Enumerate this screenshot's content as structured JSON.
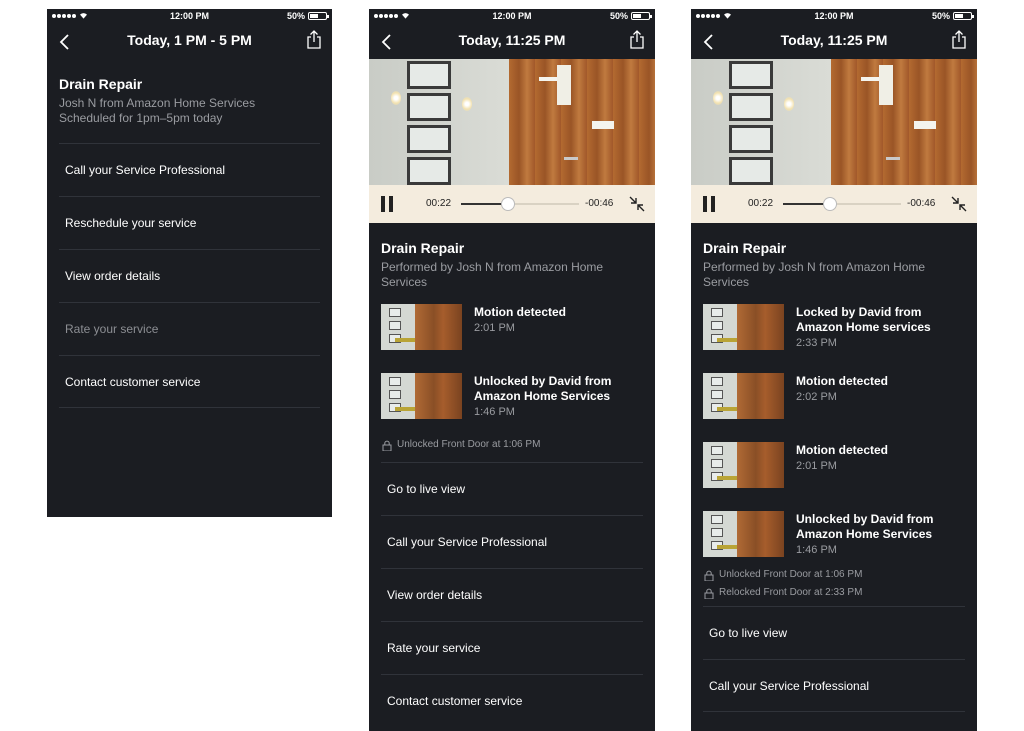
{
  "status_bar": {
    "time": "12:00 PM",
    "battery": "50%"
  },
  "phone1": {
    "nav_title": "Today, 1 PM - 5 PM",
    "service": {
      "title": "Drain Repair",
      "line1": "Josh N from Amazon Home Services",
      "line2": "Scheduled for 1pm–5pm today"
    },
    "menu": [
      {
        "label": "Call your Service Professional",
        "disabled": false
      },
      {
        "label": "Reschedule your service",
        "disabled": false
      },
      {
        "label": "View order details",
        "disabled": false
      },
      {
        "label": "Rate your service",
        "disabled": true
      },
      {
        "label": "Contact customer service",
        "disabled": false
      }
    ]
  },
  "phone2": {
    "nav_title": "Today, 11:25 PM",
    "video": {
      "elapsed": "00:22",
      "remaining": "-00:46",
      "progress": 0.4
    },
    "service": {
      "title": "Drain Repair",
      "subtitle": "Performed by Josh N from Amazon Home Services"
    },
    "events": [
      {
        "title": "Motion detected",
        "time": "2:01 PM"
      },
      {
        "title": "Unlocked by David from Amazon Home Services",
        "time": "1:46 PM"
      }
    ],
    "lock_events": [
      "Unlocked Front Door at 1:06 PM"
    ],
    "menu": [
      "Go to live view",
      "Call your Service Professional",
      "View order details",
      "Rate your service",
      "Contact customer service"
    ]
  },
  "phone3": {
    "nav_title": "Today, 11:25 PM",
    "video": {
      "elapsed": "00:22",
      "remaining": "-00:46",
      "progress": 0.4
    },
    "service": {
      "title": "Drain Repair",
      "subtitle": "Performed by Josh N from Amazon Home Services"
    },
    "events": [
      {
        "title": "Locked by David from Amazon Home services",
        "time": "2:33 PM"
      },
      {
        "title": "Motion detected",
        "time": "2:02 PM"
      },
      {
        "title": "Motion detected",
        "time": "2:01 PM"
      },
      {
        "title": "Unlocked by David from Amazon Home Services",
        "time": "1:46 PM"
      }
    ],
    "lock_events": [
      "Unlocked Front Door at 1:06 PM",
      "Relocked Front Door at 2:33 PM"
    ],
    "menu": [
      "Go to live view",
      "Call your Service Professional"
    ]
  },
  "colors": {
    "screen_bg": "#1b1d22",
    "divider": "#30333a",
    "muted_text": "#9a9ca1",
    "player_bar": "#f4ecde"
  }
}
